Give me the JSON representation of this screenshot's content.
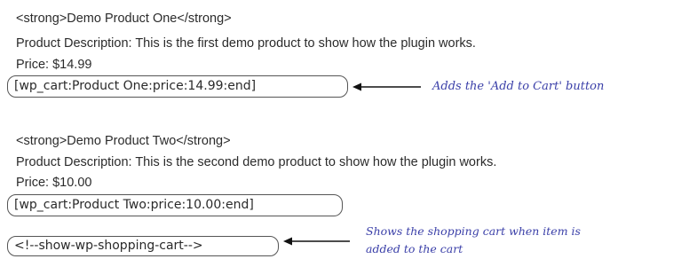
{
  "product_one": {
    "title_line": "<strong>Demo Product One</strong>",
    "description": "Product Description:  This is the first demo product to show how the plugin works.",
    "price": "Price: $14.99",
    "shortcode": "[wp_cart:Product One:price:14.99:end]"
  },
  "product_two": {
    "title_line": "<strong>Demo Product Two</strong>",
    "description": "Product Description:  This is the second demo product to show how the plugin works.",
    "price": "Price: $10.00",
    "shortcode": "[wp_cart:Product Two:price:10.00:end]"
  },
  "cart_shortcode": "<!--show-wp-shopping-cart-->",
  "annotations": {
    "add_to_cart": "Adds the 'Add to Cart' button",
    "show_cart_line1": "Shows the shopping cart when item is",
    "show_cart_line2": "added to the cart"
  },
  "colors": {
    "annotation_text": "#3a3fa8",
    "body_text": "#2b2b2b",
    "oval_border": "#555555"
  }
}
